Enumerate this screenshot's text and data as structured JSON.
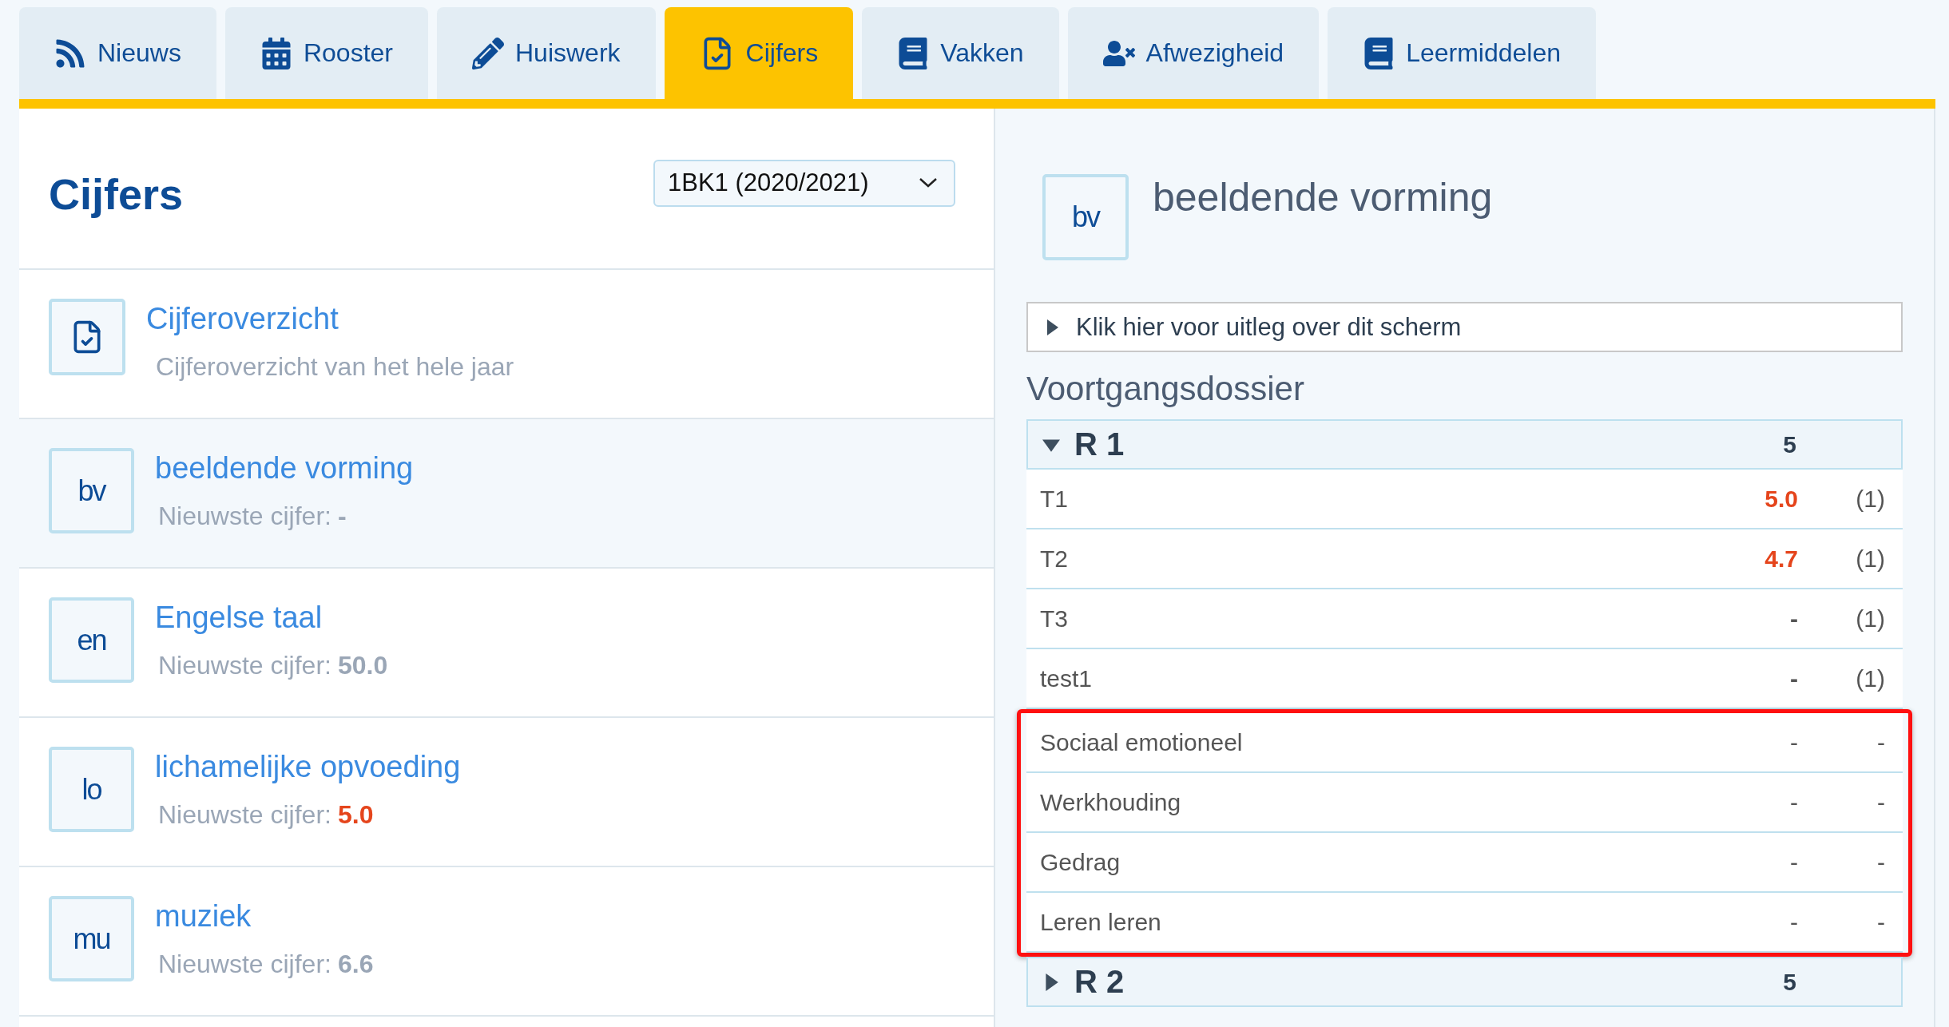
{
  "tabs": [
    {
      "label": "Nieuws",
      "selected": false
    },
    {
      "label": "Rooster",
      "selected": false
    },
    {
      "label": "Huiswerk",
      "selected": false
    },
    {
      "label": "Cijfers",
      "selected": true
    },
    {
      "label": "Vakken",
      "selected": false
    },
    {
      "label": "Afwezigheid",
      "selected": false
    },
    {
      "label": "Leermiddelen",
      "selected": false
    }
  ],
  "sidebar": {
    "title": "Cijfers",
    "period_select": {
      "value": "1BK1 (2020/2021)"
    },
    "items": [
      {
        "kind": "overview",
        "title": "Cijferoverzicht",
        "description": "Cijferoverzicht van het hele jaar",
        "selected": false
      },
      {
        "kind": "subject",
        "abbreviation": "bv",
        "title": "beeldende vorming",
        "latest_label": "Nieuwste cijfer:",
        "latest_value": "-",
        "insufficient": false,
        "selected": true
      },
      {
        "kind": "subject",
        "abbreviation": "en",
        "title": "Engelse taal",
        "latest_label": "Nieuwste cijfer:",
        "latest_value": "50.0",
        "insufficient": false,
        "selected": false
      },
      {
        "kind": "subject",
        "abbreviation": "lo",
        "title": "lichamelijke opvoeding",
        "latest_label": "Nieuwste cijfer:",
        "latest_value": "5.0",
        "insufficient": true,
        "selected": false
      },
      {
        "kind": "subject",
        "abbreviation": "mu",
        "title": "muziek",
        "latest_label": "Nieuwste cijfer:",
        "latest_value": "6.6",
        "insufficient": false,
        "selected": false
      }
    ]
  },
  "detail": {
    "abbreviation": "bv",
    "title": "beeldende vorming",
    "explainer": {
      "label": "Klik hier voor uitleg over dit scherm",
      "expanded": false
    },
    "section_title": "Voortgangsdossier",
    "periods": [
      {
        "name": "R 1",
        "score": "5",
        "expanded": true,
        "rows": [
          {
            "kind": "test",
            "name": "T1",
            "grade": "5.0",
            "weight": "(1)",
            "insufficient": true,
            "highlighted": false
          },
          {
            "kind": "test",
            "name": "T2",
            "grade": "4.7",
            "weight": "(1)",
            "insufficient": true,
            "highlighted": false
          },
          {
            "kind": "test",
            "name": "T3",
            "grade": "-",
            "weight": "(1)",
            "insufficient": false,
            "highlighted": false
          },
          {
            "kind": "test",
            "name": "test1",
            "grade": "-",
            "weight": "(1)",
            "insufficient": false,
            "highlighted": false
          },
          {
            "kind": "skill",
            "name": "Sociaal emotioneel",
            "grade": "-",
            "weight": "-",
            "insufficient": false,
            "highlighted": true
          },
          {
            "kind": "skill",
            "name": "Werkhouding",
            "grade": "-",
            "weight": "-",
            "insufficient": false,
            "highlighted": true
          },
          {
            "kind": "skill",
            "name": "Gedrag",
            "grade": "-",
            "weight": "-",
            "insufficient": false,
            "highlighted": true
          },
          {
            "kind": "skill",
            "name": "Leren leren",
            "grade": "-",
            "weight": "-",
            "insufficient": false,
            "highlighted": true
          }
        ]
      },
      {
        "name": "R 2",
        "score": "5",
        "expanded": false
      }
    ]
  }
}
